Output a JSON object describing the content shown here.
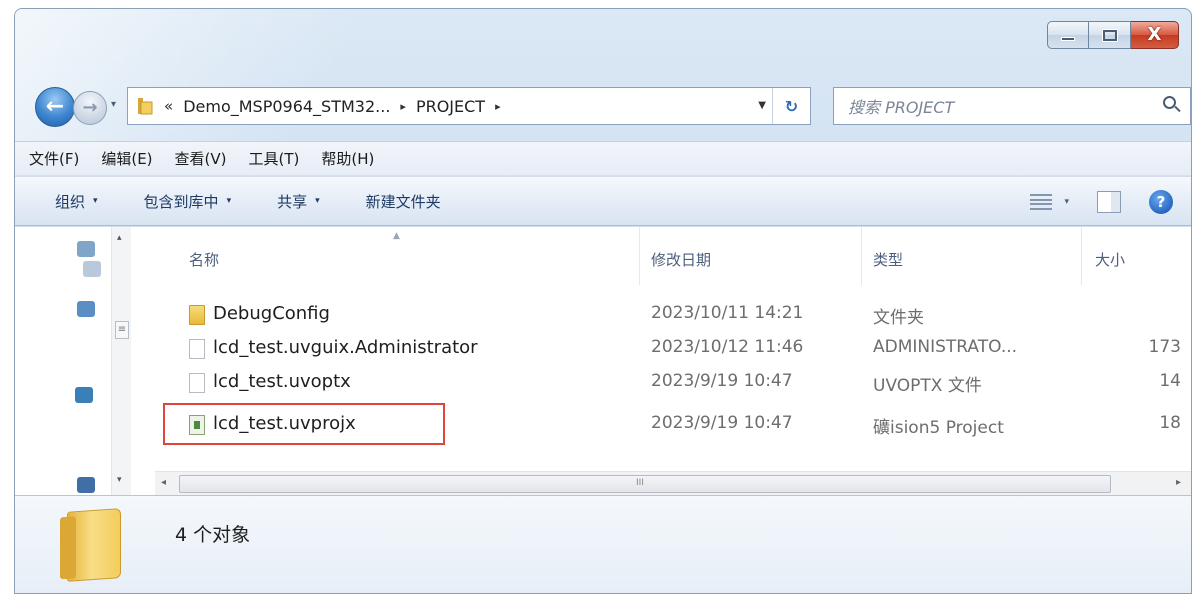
{
  "window": {
    "caption_close": "X"
  },
  "address": {
    "overflow_chevron": "«",
    "segments": [
      "Demo_MSP0964_STM32...",
      "PROJECT"
    ],
    "separator": "▸",
    "refresh_glyph": "↻"
  },
  "search": {
    "placeholder": "搜索 PROJECT"
  },
  "menu": [
    "文件(F)",
    "编辑(E)",
    "查看(V)",
    "工具(T)",
    "帮助(H)"
  ],
  "commands": {
    "items": [
      "组织",
      "包含到库中",
      "共享",
      "新建文件夹"
    ],
    "caret": "▾",
    "help_glyph": "?"
  },
  "columns": {
    "name": "名称",
    "date": "修改日期",
    "type": "类型",
    "size": "大小"
  },
  "files": [
    {
      "name": "DebugConfig",
      "date": "2023/10/11 14:21",
      "type": "文件夹",
      "size": "",
      "icon": "folder-icon"
    },
    {
      "name": "lcd_test.uvguix.Administrator",
      "date": "2023/10/12 11:46",
      "type": "ADMINISTRATO...",
      "size": "173",
      "icon": "file-icon"
    },
    {
      "name": "lcd_test.uvoptx",
      "date": "2023/9/19 10:47",
      "type": "UVOPTX 文件",
      "size": "14",
      "icon": "file-icon"
    },
    {
      "name": "lcd_test.uvprojx",
      "date": "2023/9/19 10:47",
      "type": "礦ision5 Project",
      "size": "18",
      "icon": "uvision-project-icon"
    }
  ],
  "highlight_color": "#e0453c",
  "status": {
    "object_count": "4 个对象"
  },
  "scroll": {
    "grip": "III",
    "left": "◂",
    "right": "▸",
    "up": "▴",
    "down": "▾"
  }
}
